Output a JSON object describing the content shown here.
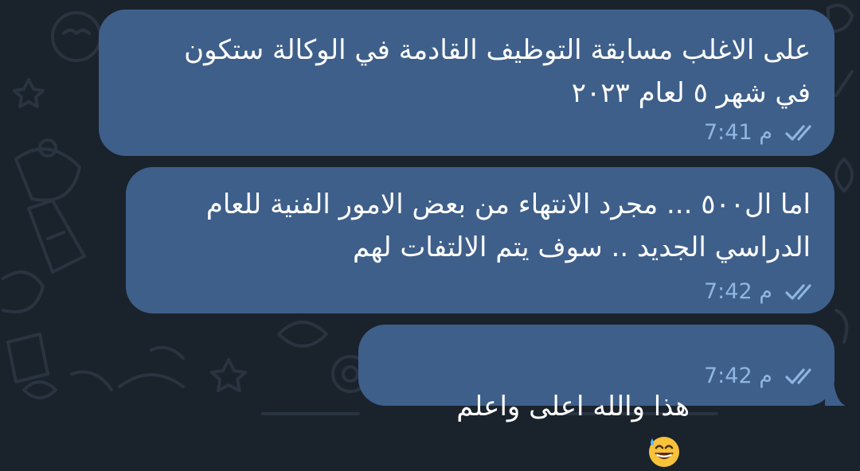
{
  "messages": [
    {
      "lines": "على الاغلب مسابقة التوظيف القادمة في الوكالة ستكون\nفي شهر ٥ لعام ٢٠٢٣",
      "time": "7:41 م",
      "status": "read"
    },
    {
      "lines": "اما ال٥٠٠ ... مجرد الانتهاء من بعض الامور الفنية للعام\nالدراسي الجديد .. سوف يتم الالتفات لهم",
      "time": "7:42 م",
      "status": "read"
    },
    {
      "lines": "هذا والله اعلى واعلم",
      "emoji": "grinning-face-with-sweat",
      "time": "7:42 م",
      "status": "read"
    }
  ],
  "colors": {
    "background": "#1a222c",
    "bubble": "#3e5f8a",
    "meta": "#8fb6e0"
  }
}
